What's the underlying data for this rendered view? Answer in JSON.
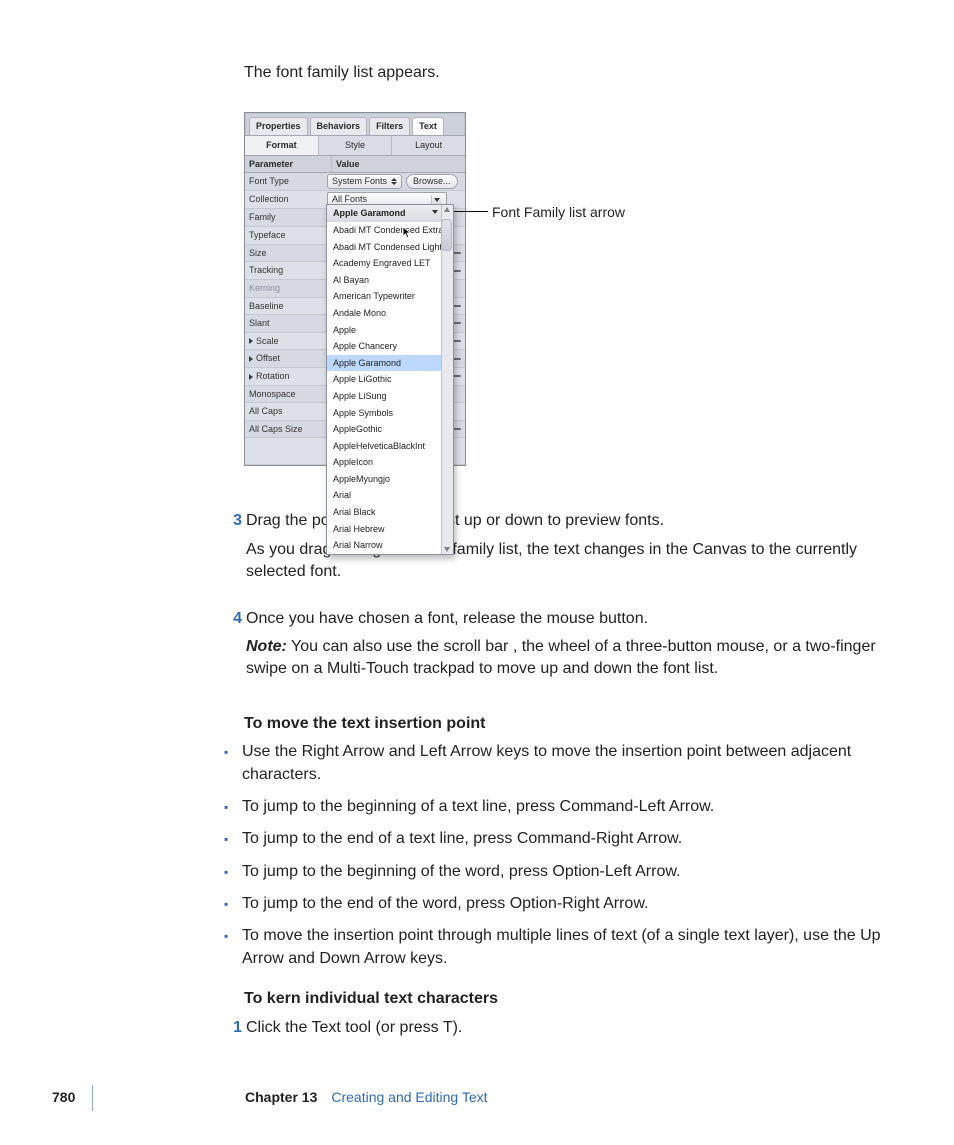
{
  "intro": "The font family list appears.",
  "callout": "Font Family list arrow",
  "panel": {
    "tabs": [
      "Properties",
      "Behaviors",
      "Filters",
      "Text"
    ],
    "activeTab": "Text",
    "subtabs": [
      "Format",
      "Style",
      "Layout"
    ],
    "activeSubtab": "Format",
    "headerParam": "Parameter",
    "headerValue": "Value",
    "rows": {
      "fontType": "Font Type",
      "fontTypeValue": "System Fonts",
      "browse": "Browse...",
      "collection": "Collection",
      "collectionValue": "All Fonts",
      "family": "Family",
      "familyValue": "Apple Garamond",
      "typeface": "Typeface",
      "size": "Size",
      "tracking": "Tracking",
      "kerning": "Kerning",
      "baseline": "Baseline",
      "slant": "Slant",
      "scale": "Scale",
      "offset": "Offset",
      "rotation": "Rotation",
      "monospace": "Monospace",
      "allCaps": "All Caps",
      "allCapsSize": "All Caps Size"
    },
    "fontList": [
      "Apple Garamond",
      "Abadi MT Condensed Extra",
      "Abadi MT Condensed Light",
      "Academy Engraved LET",
      "Al Bayan",
      "American Typewriter",
      "Andale Mono",
      "Apple",
      "Apple Chancery",
      "Apple Garamond",
      "Apple LiGothic",
      "Apple LiSung",
      "Apple Symbols",
      "AppleGothic",
      "AppleHelveticaBlackInt",
      "AppleIcon",
      "AppleMyungjo",
      "Arial",
      "Arial Black",
      "Arial Hebrew",
      "Arial Narrow"
    ],
    "highlightedIndex": 9
  },
  "steps": {
    "s3": "Drag the pointer in the font list up or down to preview fonts.",
    "s3follow": "As you drag through the font family list, the text changes in the Canvas to the currently selected font.",
    "s4": "Once you have chosen a font, release the mouse button.",
    "noteLabel": "Note:",
    "noteBody": "  You can also use the scroll bar , the wheel of a three-button mouse, or a two-finger swipe on a Multi-Touch trackpad to move up and down the font list."
  },
  "subhead1": "To move the text insertion point",
  "bullets": [
    "Use the Right Arrow and Left Arrow keys to move the insertion point between adjacent characters.",
    "To jump to the beginning of a text line, press Command-Left Arrow.",
    "To jump to the end of a text line, press Command-Right Arrow.",
    "To jump to the beginning of the word, press Option-Left Arrow.",
    "To jump to the end of the word, press Option-Right Arrow.",
    "To move the insertion point through multiple lines of text (of a single text layer), use the Up Arrow and Down Arrow keys."
  ],
  "subhead2": "To kern individual text characters",
  "kernStep1": "Click the Text tool (or press T).",
  "footer": {
    "page": "780",
    "chapter": "Chapter 13",
    "title": "Creating and Editing Text"
  }
}
